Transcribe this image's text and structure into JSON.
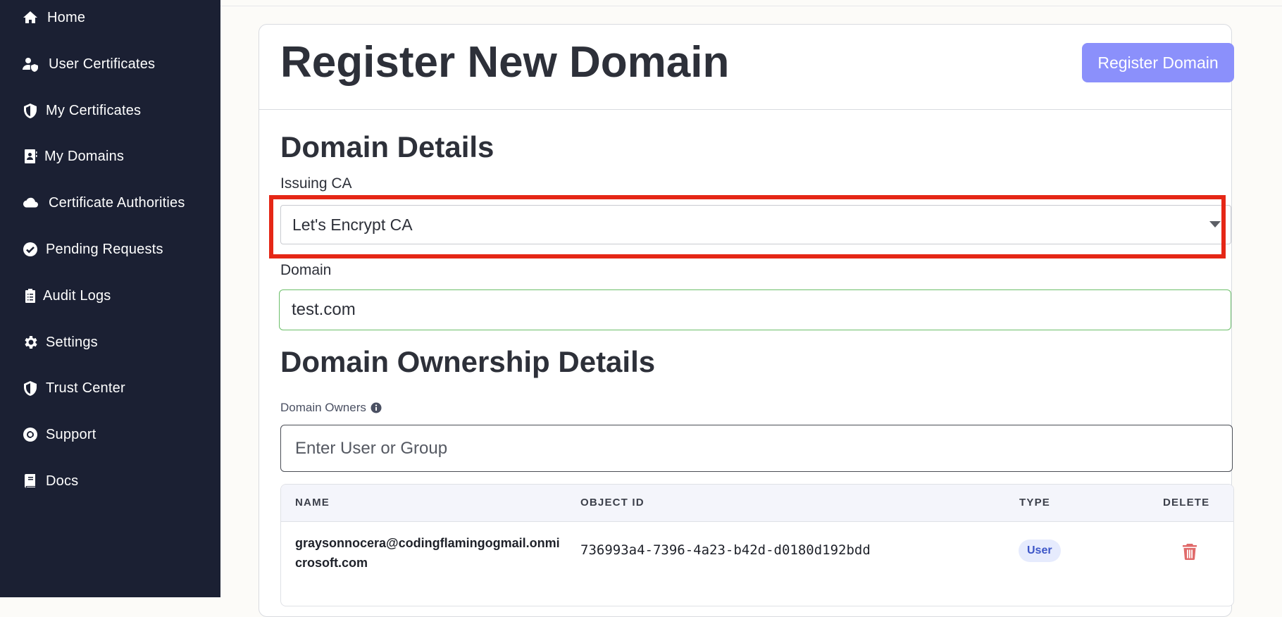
{
  "sidebar": {
    "items": [
      {
        "label": "Home",
        "icon": "home-icon"
      },
      {
        "label": "User Certificates",
        "icon": "user-shield-icon"
      },
      {
        "label": "My Certificates",
        "icon": "shield-icon"
      },
      {
        "label": "My Domains",
        "icon": "address-book-icon"
      },
      {
        "label": "Certificate Authorities",
        "icon": "cloud-icon"
      },
      {
        "label": "Pending Requests",
        "icon": "check-circle-icon"
      },
      {
        "label": "Audit Logs",
        "icon": "clipboard-icon"
      },
      {
        "label": "Settings",
        "icon": "gear-icon"
      },
      {
        "label": "Trust Center",
        "icon": "shield-icon"
      },
      {
        "label": "Support",
        "icon": "lifebuoy-icon"
      },
      {
        "label": "Docs",
        "icon": "book-icon"
      }
    ]
  },
  "header": {
    "title": "Register New Domain",
    "register_button": "Register Domain"
  },
  "domain_details": {
    "section_title": "Domain Details",
    "issuing_ca_label": "Issuing CA",
    "issuing_ca_value": "Let's Encrypt CA",
    "domain_label": "Domain",
    "domain_value": "test.com"
  },
  "ownership": {
    "section_title": "Domain Ownership Details",
    "owners_label": "Domain Owners",
    "owner_input_placeholder": "Enter User or Group",
    "table": {
      "columns": [
        "NAME",
        "OBJECT ID",
        "TYPE",
        "DELETE"
      ],
      "rows": [
        {
          "name": "graysonnocera@codingflamingogmail.onmicrosoft.com",
          "object_id": "736993a4-7396-4a23-b42d-d0180d192bdd",
          "type": "User"
        }
      ]
    }
  },
  "colors": {
    "sidebar_bg": "#1b2033",
    "primary_button": "#8b90fb",
    "highlight": "#e52716",
    "valid_border": "#6cbf6a",
    "delete_icon": "#e06b6b"
  }
}
